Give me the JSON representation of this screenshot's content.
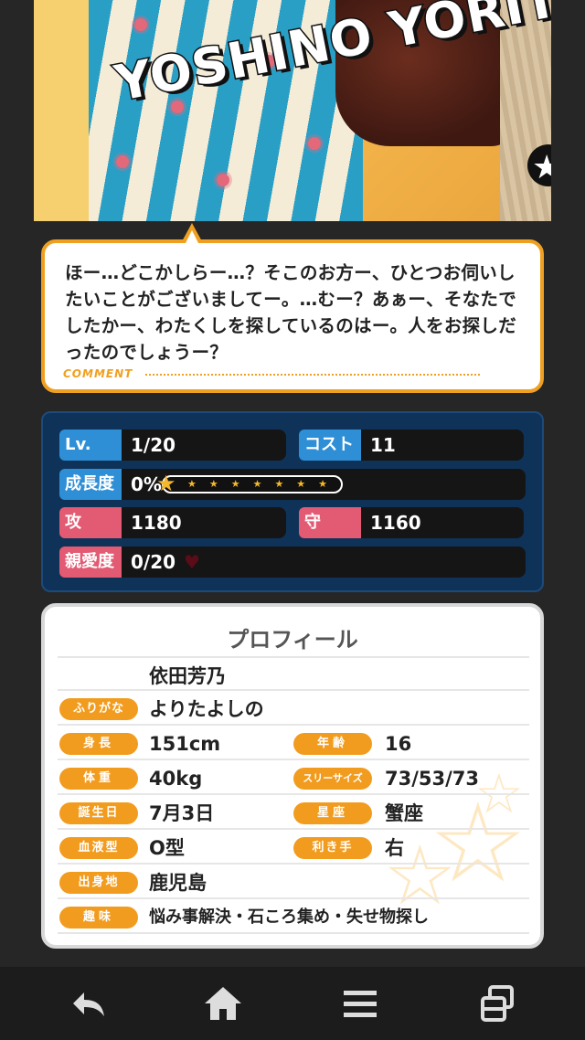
{
  "card": {
    "name": "YOSHINO YORITA",
    "star_icon": "star-icon"
  },
  "comment": {
    "text": "ほー…どこかしらー…？そこのお方ー、ひとつお伺いしたいことがございましてー。…むー？あぁー、そなたでしたかー、わたくしを探しているのはー。人をお探しだったのでしょうー？",
    "label": "COMMENT"
  },
  "stats": {
    "level_label": "Lv.",
    "level_value": "1/20",
    "cost_label": "コスト",
    "cost_value": "11",
    "growth_label": "成長度",
    "growth_value": "0%",
    "growth_fraction": 0,
    "attack_label": "攻",
    "attack_value": "1180",
    "defense_label": "守",
    "defense_value": "1160",
    "affection_label": "親愛度",
    "affection_value": "0/20",
    "heart_icon": "heart-icon"
  },
  "profile": {
    "title": "プロフィール",
    "name": "依田芳乃",
    "furigana_label": "ふりがな",
    "furigana": "よりたよしの",
    "height_label": "身長",
    "height": "151cm",
    "age_label": "年齢",
    "age": "16",
    "weight_label": "体重",
    "weight": "40kg",
    "sizes_label": "スリーサイズ",
    "sizes": "73/53/73",
    "birthday_label": "誕生日",
    "birthday": "7月3日",
    "sign_label": "星座",
    "sign": "蟹座",
    "blood_label": "血液型",
    "blood": "O型",
    "hand_label": "利き手",
    "hand": "右",
    "hometown_label": "出身地",
    "hometown": "鹿児島",
    "hobby_label": "趣味",
    "hobby": "悩み事解決・石ころ集め・失せ物探し"
  },
  "nav": {
    "back_icon": "back-arrow-icon",
    "home_icon": "home-icon",
    "menu_icon": "menu-icon",
    "windows_icon": "windows-icon"
  },
  "colors": {
    "accent_orange": "#f0a020",
    "stats_bg": "#0f3358",
    "tag_blue": "#2f8fd6",
    "tag_red": "#e35a73"
  }
}
